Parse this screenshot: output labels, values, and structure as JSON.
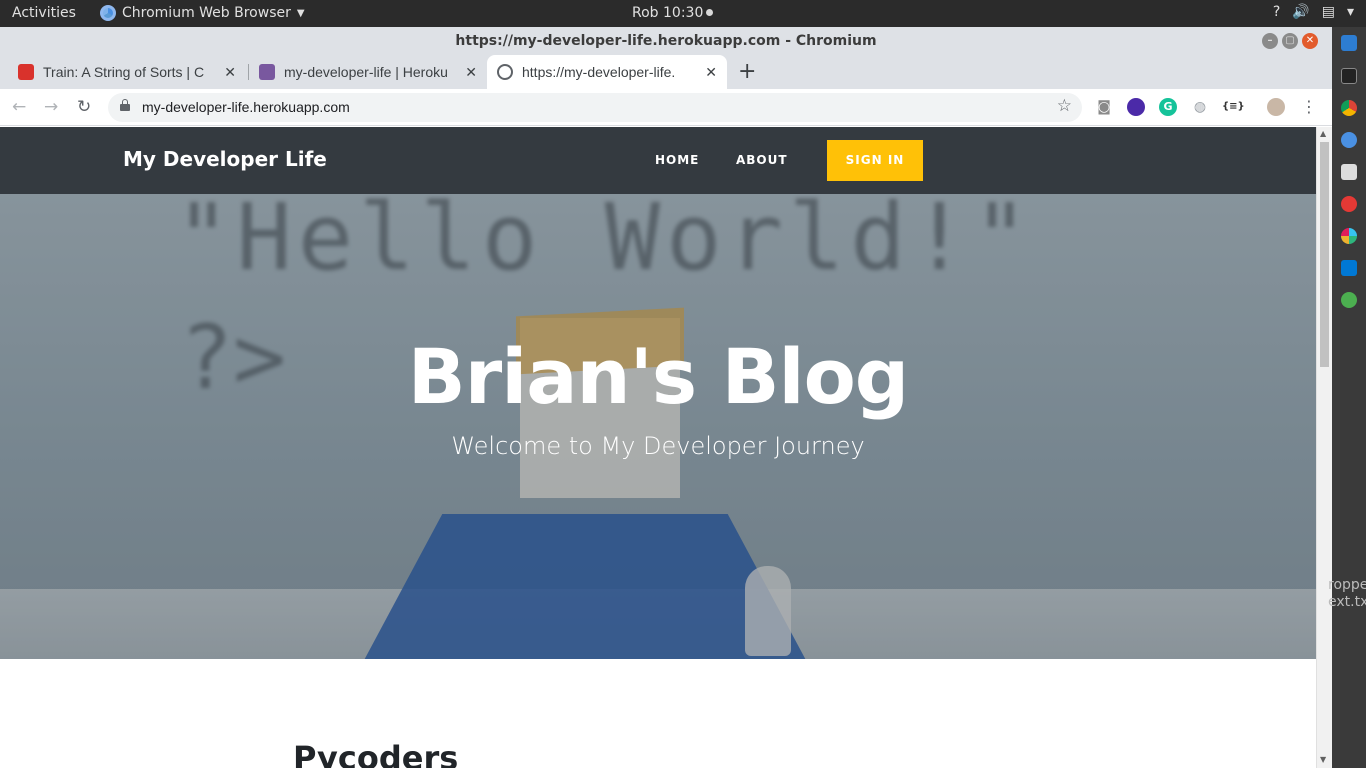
{
  "topbar": {
    "activities": "Activities",
    "app_name": "Chromium Web Browser",
    "clock": "Rob 10:30",
    "tray_help": "?",
    "tray_volume": "🔊",
    "tray_menu": "▾"
  },
  "window": {
    "title": "https://my-developer-life.herokuapp.com - Chromium"
  },
  "tabs": [
    {
      "label": "Train: A String of Sorts | C",
      "favicon_color": "#d9322c"
    },
    {
      "label": "my-developer-life | Heroku",
      "favicon_color": "#79589f"
    },
    {
      "label": "https://my-developer-life.",
      "favicon_color": "#5f6368"
    }
  ],
  "omnibox": {
    "url": "my-developer-life.herokuapp.com"
  },
  "site": {
    "brand": "My Developer Life",
    "nav": {
      "home": "HOME",
      "about": "ABOUT",
      "signin": "SIGN IN"
    },
    "hero": {
      "title": "Brian's Blog",
      "subtitle": "Welcome to My Developer Journey",
      "bg_code_line1": "\"Hello World!\"",
      "bg_code_line2": "?>"
    },
    "post_title": "Pycoders"
  },
  "desktop": {
    "file_label_line1": "roppe",
    "file_label_line2": "ext.tx"
  },
  "colors": {
    "accent": "#ffc107",
    "navbar": "#343a40"
  }
}
